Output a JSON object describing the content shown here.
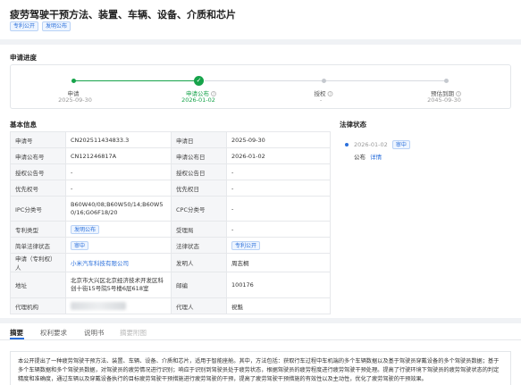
{
  "header": {
    "title": "疲劳驾驶干预方法、装置、车辆、设备、介质和芯片",
    "tags": [
      "专利公开",
      "发明公布"
    ]
  },
  "progress": {
    "title": "申请进度",
    "steps": [
      {
        "label": "申请",
        "date": "2025-09-30",
        "state": "done"
      },
      {
        "label": "申请公布",
        "date": "2026-01-02",
        "state": "current"
      },
      {
        "label": "授权",
        "date": "-",
        "state": "pending"
      },
      {
        "label": "预估到期",
        "date": "2045-09-30",
        "state": "pending"
      }
    ]
  },
  "basic_info": {
    "title": "基本信息",
    "rows": [
      {
        "l1": "申请号",
        "v1": "CN202511434833.3",
        "l2": "申请日",
        "v2": "2025-09-30"
      },
      {
        "l1": "申请公布号",
        "v1": "CN121246817A",
        "l2": "申请公布日",
        "v2": "2026-01-02"
      },
      {
        "l1": "授权公告号",
        "v1": "-",
        "l2": "授权公告日",
        "v2": "-"
      },
      {
        "l1": "优先权号",
        "v1": "-",
        "l2": "优先权日",
        "v2": "-"
      },
      {
        "l1": "IPC分类号",
        "v1": "B60W40/08;B60W50/14;B60W50/16;G06F18/20",
        "l2": "CPC分类号",
        "v2": "-"
      },
      {
        "l1": "专利类型",
        "v1": "发明公布",
        "l2": "受理局",
        "v2": "-"
      },
      {
        "l1": "简单法律状态",
        "v1": "审中",
        "l2": "法律状态",
        "v2": "专利公开"
      },
      {
        "l1": "申请（专利权）人",
        "v1": "小米汽车科技有限公司",
        "l2": "发明人",
        "v2": "周志桐"
      },
      {
        "l1": "地址",
        "v1": "北京市大兴区北京经济技术开发区科创十街15号院5号楼6层618室",
        "l2": "邮编",
        "v2": "100176"
      },
      {
        "l1": "代理机构",
        "v1": "",
        "l2": "代理人",
        "v2": "祝魁"
      }
    ]
  },
  "legal_status": {
    "title": "法律状态",
    "date": "2026-01-02",
    "badge": "审中",
    "event": "公布",
    "detail_link": "详情"
  },
  "tabs": [
    "摘要",
    "权利要求",
    "说明书",
    "摘要附图"
  ],
  "abstract": {
    "text": "本公开提出了一种疲劳驾驶干预方法、装置、车辆、设备、介质和芯片，适用于智能座舱。其中，方法包括：获取行车过程中车机端的多个车辆数据以及基于驾驶员穿戴设备的多个驾驶员数据；基于多个车辆数据和多个驾驶员数据，对驾驶员的疲劳情况进行识别；响应于识别到驾驶员处于疲劳状态，根据驾驶员的疲劳程度进行疲劳驾驶干预处理。提高了行驶环境下驾驶员的疲劳驾驶状态的判定精度和准确度，通过车辆以及穿戴设备执行的目标疲劳驾驶干预措施进行疲劳驾驶的干预，提高了疲劳驾驶干预措施的有效性以及主动性，优化了疲劳驾驶的干预效果。"
  },
  "colors": {
    "accent": "#2a6fdb",
    "done": "#16a34a",
    "pending": "#c5c9cf"
  }
}
